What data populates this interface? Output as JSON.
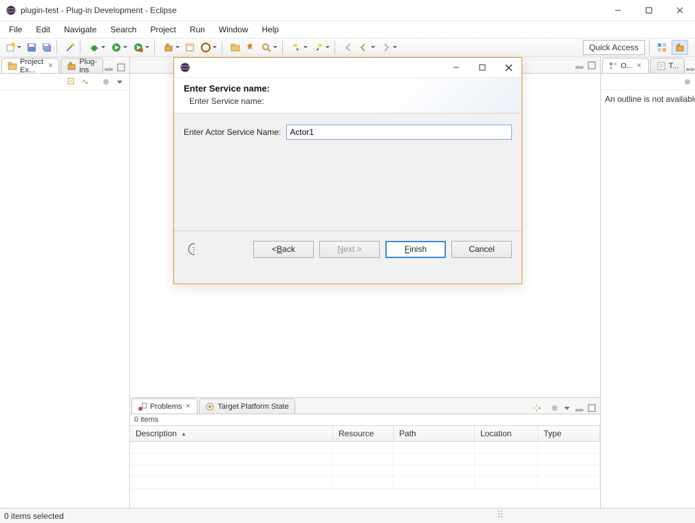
{
  "window": {
    "title": "plugin-test - Plug-in Development - Eclipse"
  },
  "menu": {
    "items": [
      "File",
      "Edit",
      "Navigate",
      "Search",
      "Project",
      "Run",
      "Window",
      "Help"
    ]
  },
  "toolbar": {
    "quick_access": "Quick Access"
  },
  "left_views": {
    "project_explorer": {
      "label": "Project Ex..."
    },
    "plugins": {
      "label": "Plug-ins"
    }
  },
  "right_views": {
    "outline": {
      "label": "O..."
    },
    "tasklist": {
      "label": "T..."
    },
    "outline_empty_msg": "An outline is not available."
  },
  "bottom_views": {
    "problems": {
      "label": "Problems",
      "items_label": "0 items",
      "columns": [
        "Description",
        "Resource",
        "Path",
        "Location",
        "Type"
      ]
    },
    "target_platform": {
      "label": "Target Platform State"
    }
  },
  "dialog": {
    "banner_title": "Enter Service name:",
    "banner_sub": "Enter Service name:",
    "field_label": "Enter Actor Service Name:",
    "field_value": "Actor1",
    "buttons": {
      "back": "Back",
      "back_prefix": "< ",
      "next": "Next >",
      "finish": "Finish",
      "cancel": "Cancel"
    }
  },
  "statusbar": {
    "msg": "0 items selected"
  },
  "colors": {
    "dialog_border": "#e49427",
    "focus_blue": "#3b8bd6"
  }
}
